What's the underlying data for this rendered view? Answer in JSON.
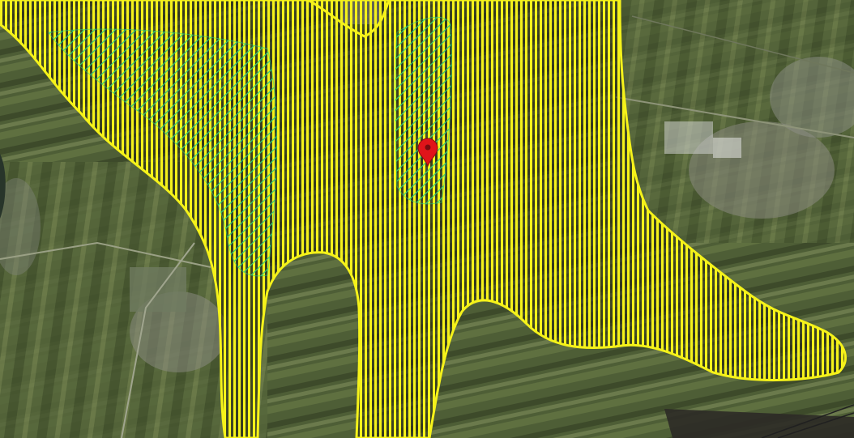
{
  "map": {
    "view": "satellite",
    "overlay_color": "#f5f21a",
    "overlay_stripe_color": "#2a2a10",
    "secondary_overlay_color": "#2fd07a",
    "marker_color": "#e0141a",
    "marker_icon": "map-pin-icon"
  }
}
